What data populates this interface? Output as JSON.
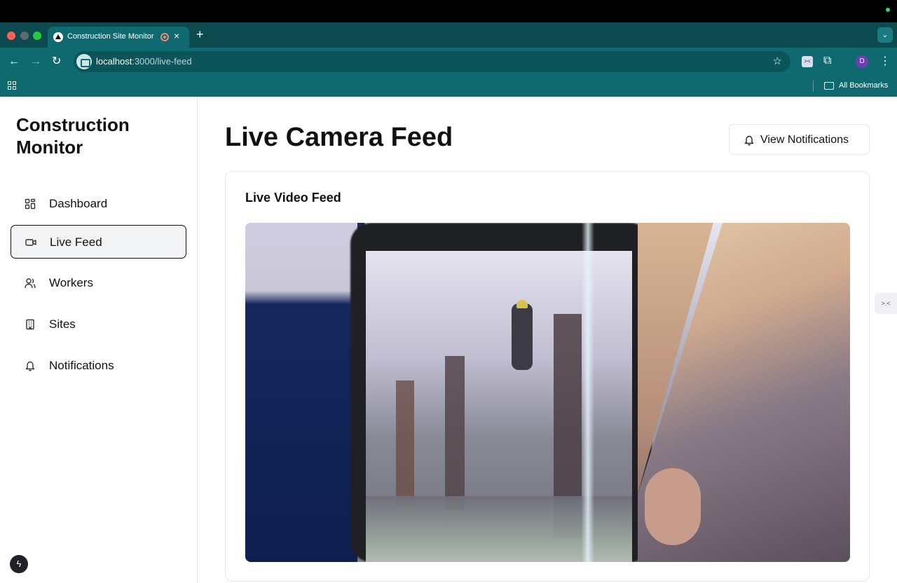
{
  "browser": {
    "tab_title": "Construction Site Monitor",
    "new_tab_icon": "+",
    "tab_close_icon": "×",
    "url_host": "localhost",
    "url_path": ":3000/live-feed",
    "bookmarks_label": "All Bookmarks",
    "profile_initial": "D"
  },
  "sidebar": {
    "brand": "Construction Monitor",
    "items": [
      {
        "label": "Dashboard",
        "icon": "dashboard-icon"
      },
      {
        "label": "Live Feed",
        "icon": "video-camera-icon",
        "active": true
      },
      {
        "label": "Workers",
        "icon": "users-icon"
      },
      {
        "label": "Sites",
        "icon": "building-icon"
      },
      {
        "label": "Notifications",
        "icon": "bell-icon"
      }
    ]
  },
  "main": {
    "title": "Live Camera Feed",
    "notifications_button": "View Notifications",
    "card_title": "Live Video Feed"
  },
  "colors": {
    "browser_chrome": "#0f6a70",
    "text_primary": "#111111",
    "border": "#e5e7eb"
  }
}
